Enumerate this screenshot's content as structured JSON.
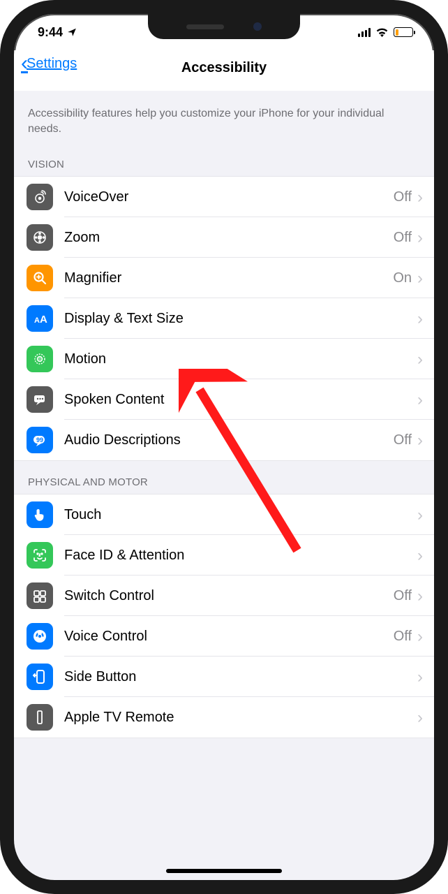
{
  "status": {
    "time": "9:44"
  },
  "nav": {
    "back": "Settings",
    "title": "Accessibility"
  },
  "description": "Accessibility features help you customize your iPhone for your individual needs.",
  "sections": {
    "vision": {
      "header": "VISION",
      "rows": {
        "voiceover": {
          "label": "VoiceOver",
          "value": "Off"
        },
        "zoom": {
          "label": "Zoom",
          "value": "Off"
        },
        "magnifier": {
          "label": "Magnifier",
          "value": "On"
        },
        "display": {
          "label": "Display & Text Size",
          "value": ""
        },
        "motion": {
          "label": "Motion",
          "value": ""
        },
        "spoken": {
          "label": "Spoken Content",
          "value": ""
        },
        "audio": {
          "label": "Audio Descriptions",
          "value": "Off"
        }
      }
    },
    "motor": {
      "header": "PHYSICAL AND MOTOR",
      "rows": {
        "touch": {
          "label": "Touch",
          "value": ""
        },
        "faceid": {
          "label": "Face ID & Attention",
          "value": ""
        },
        "switch": {
          "label": "Switch Control",
          "value": "Off"
        },
        "voice": {
          "label": "Voice Control",
          "value": "Off"
        },
        "side": {
          "label": "Side Button",
          "value": ""
        },
        "appletv": {
          "label": "Apple TV Remote",
          "value": ""
        }
      }
    }
  }
}
